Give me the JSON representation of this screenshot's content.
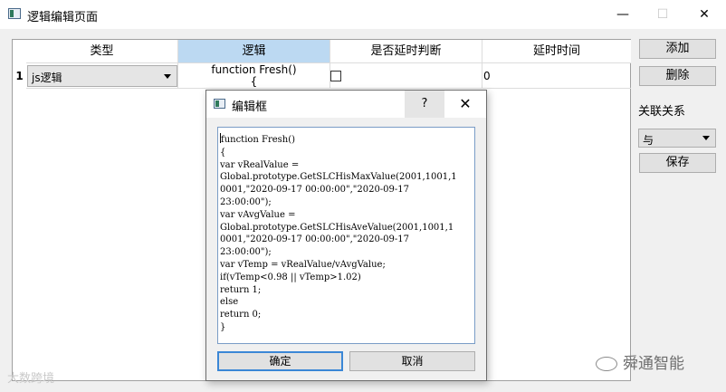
{
  "window": {
    "title": "逻辑编辑页面",
    "minimize": "—",
    "maximize": "☐",
    "close": "✕"
  },
  "table": {
    "headers": [
      "类型",
      "逻辑",
      "是否延时判断",
      "延时时间"
    ],
    "rows": [
      {
        "index": "1",
        "type": "js逻辑",
        "logic_preview": "function Fresh()\n{",
        "delay_check": false,
        "delay_time": "0"
      }
    ]
  },
  "side_panel": {
    "add_label": "添加",
    "delete_label": "删除",
    "relation_label": "关联关系",
    "relation_value": "与",
    "save_label": "保存"
  },
  "dialog": {
    "title": "编辑框",
    "help": "?",
    "close": "✕",
    "code_lines": [
      "function Fresh()",
      "{",
      "var vRealValue =",
      "Global.prototype.GetSLCHisMaxValue(2001,1001,1",
      "0001,\"2020-09-17 00:00:00\",\"2020-09-17",
      "23:00:00\");",
      "var vAvgValue =",
      "Global.prototype.GetSLCHisAveValue(2001,1001,1",
      "0001,\"2020-09-17 00:00:00\",\"2020-09-17",
      "23:00:00\");",
      "var vTemp = vRealValue/vAvgValue;",
      "if(vTemp<0.98 || vTemp>1.02)",
      "return 1;",
      "else",
      "return 0;",
      "}"
    ],
    "ok_label": "确定",
    "cancel_label": "取消"
  },
  "watermarks": {
    "left": "大数跨境",
    "right": "舜通智能"
  },
  "colors": {
    "selected_header": "#bcd9f2",
    "focus_border": "#3b87d6"
  }
}
